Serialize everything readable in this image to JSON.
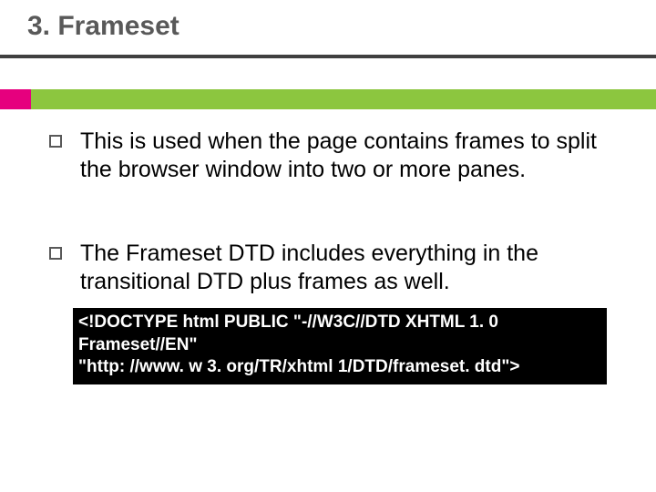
{
  "title": "3. Frameset",
  "bullets": [
    "This is used when the page contains frames to split the browser window into two or more panes.",
    "The Frameset DTD includes everything in the transitional DTD plus frames as well."
  ],
  "code": {
    "line1": "<!DOCTYPE html PUBLIC \"-//W3C//DTD XHTML 1. 0 Frameset//EN\"",
    "line2": "\"http: //www. w 3. org/TR/xhtml 1/DTD/frameset. dtd\">"
  }
}
